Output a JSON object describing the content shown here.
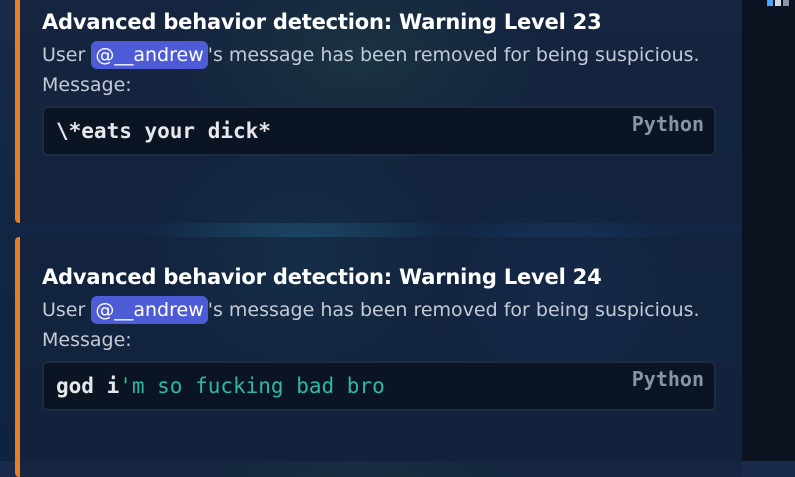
{
  "embeds": [
    {
      "title": "Advanced behavior detection: Warning Level 23",
      "desc_prefix": "User ",
      "mention": "@__andrew",
      "desc_suffix": "'s message has been removed for being suspicious.",
      "desc_line2": "Message:",
      "code_lang": "Python",
      "code_plain": "\\*eats your dick*",
      "code_string": ""
    },
    {
      "title": "Advanced behavior detection: Warning Level 24",
      "desc_prefix": "User ",
      "mention": "@__andrew",
      "desc_suffix": "'s message has been removed for being suspicious.",
      "desc_line2": "Message:",
      "code_lang": "Python",
      "code_plain": "god i",
      "code_string": "'m so fucking bad bro"
    }
  ],
  "colors": {
    "accent_bar": "#e67e22",
    "mention_bg": "#5865f2",
    "code_string": "#2fb8a4"
  }
}
